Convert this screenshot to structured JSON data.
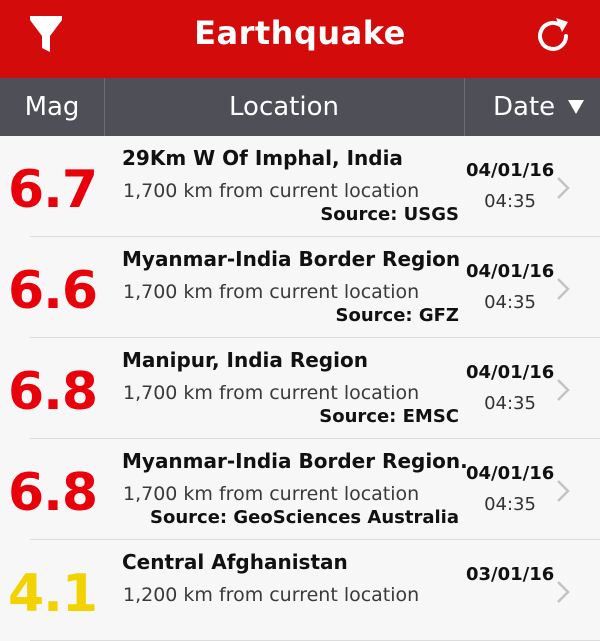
{
  "nav": {
    "title": "Earthquake",
    "filter_icon": "filter-icon",
    "refresh_icon": "refresh-icon"
  },
  "header": {
    "mag": "Mag",
    "location": "Location",
    "date": "Date"
  },
  "colors": {
    "nav": "#d40b0b",
    "header": "#4e4f57",
    "mag_high": "#e8000b",
    "mag_low": "#f2d200"
  },
  "quakes": [
    {
      "mag": "6.7",
      "title": "29Km W Of Imphal, India",
      "distance": "1,700 km from current location",
      "source": "Source: USGS",
      "date": "04/01/16",
      "time": "04:35"
    },
    {
      "mag": "6.6",
      "title": "Myanmar-India Border Region",
      "distance": "1,700 km from current location",
      "source": "Source: GFZ",
      "date": "04/01/16",
      "time": "04:35"
    },
    {
      "mag": "6.8",
      "title": "Manipur, India Region",
      "distance": "1,700 km from current location",
      "source": "Source: EMSC",
      "date": "04/01/16",
      "time": "04:35"
    },
    {
      "mag": "6.8",
      "title": "Myanmar-India Border Region.",
      "distance": "1,700 km from current location",
      "source": "Source: GeoSciences Australia",
      "date": "04/01/16",
      "time": "04:35"
    },
    {
      "mag": "4.1",
      "title": "Central Afghanistan",
      "distance": "1,200 km from current location",
      "source": "",
      "date": "03/01/16",
      "time": ""
    }
  ]
}
